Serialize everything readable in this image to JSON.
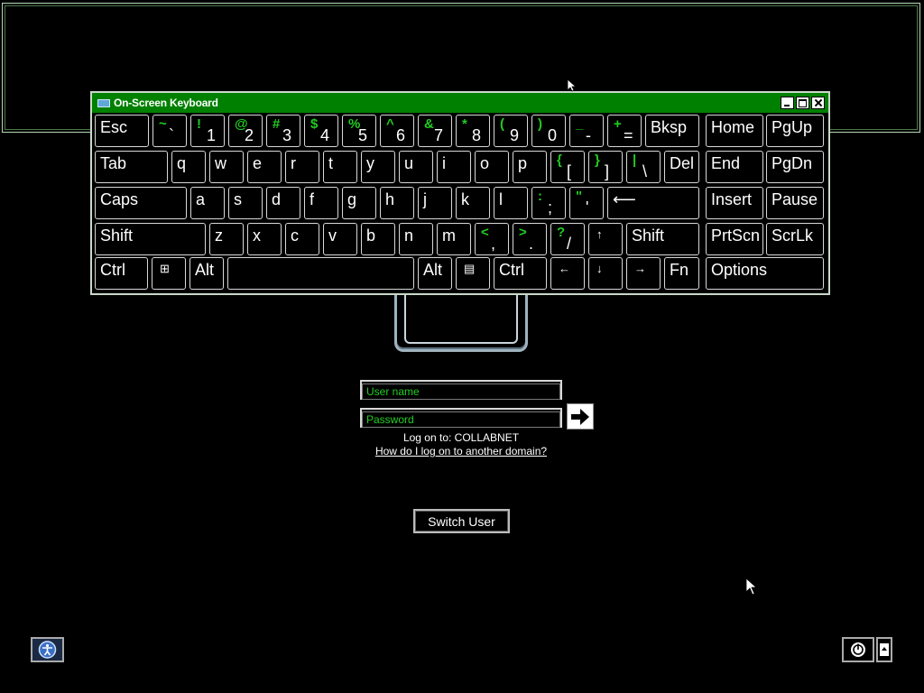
{
  "osk": {
    "title": "On-Screen Keyboard",
    "rows": [
      [
        {
          "id": "esc",
          "main": "Esc"
        },
        {
          "id": "backtick",
          "shift": "~",
          "base": "`"
        },
        {
          "id": "1",
          "shift": "!",
          "base": "1"
        },
        {
          "id": "2",
          "shift": "@",
          "base": "2"
        },
        {
          "id": "3",
          "shift": "#",
          "base": "3"
        },
        {
          "id": "4",
          "shift": "$",
          "base": "4"
        },
        {
          "id": "5",
          "shift": "%",
          "base": "5"
        },
        {
          "id": "6",
          "shift": "^",
          "base": "6"
        },
        {
          "id": "7",
          "shift": "&",
          "base": "7"
        },
        {
          "id": "8",
          "shift": "*",
          "base": "8"
        },
        {
          "id": "9",
          "shift": "(",
          "base": "9"
        },
        {
          "id": "0",
          "shift": ")",
          "base": "0"
        },
        {
          "id": "minus",
          "shift": "_",
          "base": "-"
        },
        {
          "id": "equals",
          "shift": "+",
          "base": "="
        },
        {
          "id": "bksp",
          "main": "Bksp"
        },
        {
          "id": "home",
          "main": "Home"
        },
        {
          "id": "pgup",
          "main": "PgUp"
        }
      ],
      [
        {
          "id": "tab",
          "main": "Tab"
        },
        {
          "id": "q",
          "main": "q"
        },
        {
          "id": "w",
          "main": "w"
        },
        {
          "id": "e",
          "main": "e"
        },
        {
          "id": "r",
          "main": "r"
        },
        {
          "id": "t",
          "main": "t"
        },
        {
          "id": "y",
          "main": "y"
        },
        {
          "id": "u",
          "main": "u"
        },
        {
          "id": "i",
          "main": "i"
        },
        {
          "id": "o",
          "main": "o"
        },
        {
          "id": "p",
          "main": "p"
        },
        {
          "id": "lbracket",
          "shift": "{",
          "base": "["
        },
        {
          "id": "rbracket",
          "shift": "}",
          "base": "]"
        },
        {
          "id": "backslash",
          "shift": "|",
          "base": "\\"
        },
        {
          "id": "del",
          "main": "Del"
        },
        {
          "id": "end",
          "main": "End"
        },
        {
          "id": "pgdn",
          "main": "PgDn"
        }
      ],
      [
        {
          "id": "caps",
          "main": "Caps"
        },
        {
          "id": "a",
          "main": "a"
        },
        {
          "id": "s",
          "main": "s"
        },
        {
          "id": "d",
          "main": "d"
        },
        {
          "id": "f",
          "main": "f"
        },
        {
          "id": "g",
          "main": "g"
        },
        {
          "id": "h",
          "main": "h"
        },
        {
          "id": "j",
          "main": "j"
        },
        {
          "id": "k",
          "main": "k"
        },
        {
          "id": "l",
          "main": "l"
        },
        {
          "id": "semicolon",
          "shift": ":",
          "base": ";"
        },
        {
          "id": "quote",
          "shift": "\"",
          "base": "'"
        },
        {
          "id": "enter",
          "main": "⟵"
        },
        {
          "id": "insert",
          "main": "Insert"
        },
        {
          "id": "pause",
          "main": "Pause"
        }
      ],
      [
        {
          "id": "lshift",
          "main": "Shift"
        },
        {
          "id": "z",
          "main": "z"
        },
        {
          "id": "x",
          "main": "x"
        },
        {
          "id": "c",
          "main": "c"
        },
        {
          "id": "v",
          "main": "v"
        },
        {
          "id": "b",
          "main": "b"
        },
        {
          "id": "n",
          "main": "n"
        },
        {
          "id": "m",
          "main": "m"
        },
        {
          "id": "comma",
          "shift": "<",
          "base": ","
        },
        {
          "id": "period",
          "shift": ">",
          "base": "."
        },
        {
          "id": "slash",
          "shift": "?",
          "base": "/"
        },
        {
          "id": "up",
          "glyph": "↑"
        },
        {
          "id": "rshift",
          "main": "Shift"
        },
        {
          "id": "prtscn",
          "main": "PrtScn"
        },
        {
          "id": "scrlk",
          "main": "ScrLk"
        }
      ],
      [
        {
          "id": "lctrl",
          "main": "Ctrl"
        },
        {
          "id": "win",
          "glyph": "⊞"
        },
        {
          "id": "lalt",
          "main": "Alt"
        },
        {
          "id": "space",
          "main": ""
        },
        {
          "id": "ralt",
          "main": "Alt"
        },
        {
          "id": "menu",
          "glyph": "▤"
        },
        {
          "id": "rctrl",
          "main": "Ctrl"
        },
        {
          "id": "left",
          "glyph": "←"
        },
        {
          "id": "down",
          "glyph": "↓"
        },
        {
          "id": "right",
          "glyph": "→"
        },
        {
          "id": "fn",
          "main": "Fn"
        },
        {
          "id": "options",
          "main": "Options"
        }
      ]
    ]
  },
  "login": {
    "username_placeholder": "User name",
    "password_placeholder": "Password",
    "logon_to": "Log on to: COLLABNET",
    "domain_link": "How do I log on to another domain?",
    "switch_user": "Switch User"
  },
  "colors": {
    "accent_green": "#22cc22",
    "titlebar_green": "#008000"
  }
}
